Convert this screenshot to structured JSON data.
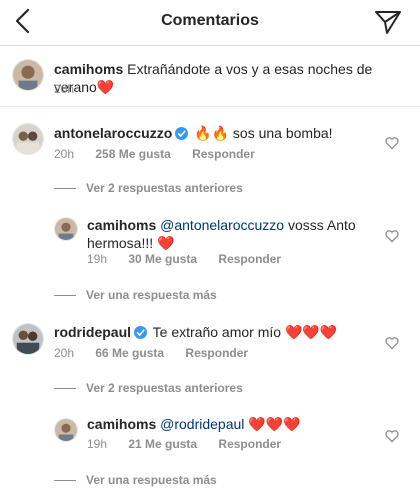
{
  "header": {
    "title": "Comentarios"
  },
  "caption": {
    "username": "camihoms",
    "text": "Extrañándote a vos y a esas noches de verano",
    "emoji": "❤️",
    "time": "20h"
  },
  "comments": [
    {
      "username": "antonelaroccuzzo",
      "verified": true,
      "emoji": "🔥🔥",
      "text": "sos una bomba!",
      "time": "20h",
      "likes": "258 Me gusta",
      "reply_label": "Responder",
      "prev_replies": "Ver 2 respuestas anteriores",
      "reply": {
        "username": "camihoms",
        "mention": "@antonelaroccuzzo",
        "text": "vosss Anto",
        "text2": "hermosa!!!",
        "emoji": "❤️",
        "time": "19h",
        "likes": "30 Me gusta",
        "reply_label": "Responder"
      },
      "more_replies": "Ver una respuesta más"
    },
    {
      "username": "rodridepaul",
      "verified": true,
      "text": "Te extraño amor mío",
      "emoji": "❤️❤️❤️",
      "time": "20h",
      "likes": "66 Me gusta",
      "reply_label": "Responder",
      "prev_replies": "Ver 2 respuestas anteriores",
      "reply": {
        "username": "camihoms",
        "mention": "@rodridepaul",
        "emoji": "❤️❤️❤️",
        "time": "19h",
        "likes": "21 Me gusta",
        "reply_label": "Responder"
      },
      "more_replies": "Ver una respuesta más"
    }
  ],
  "icons": {
    "back": "chevron-left-icon",
    "send": "paper-plane-icon",
    "like": "heart-outline-icon",
    "verified": "verified-badge-icon"
  },
  "colors": {
    "text": "#262626",
    "secondary": "#8e8e8e",
    "mention": "#00376b",
    "verified": "#3897f0",
    "heart": "#e0245e"
  }
}
